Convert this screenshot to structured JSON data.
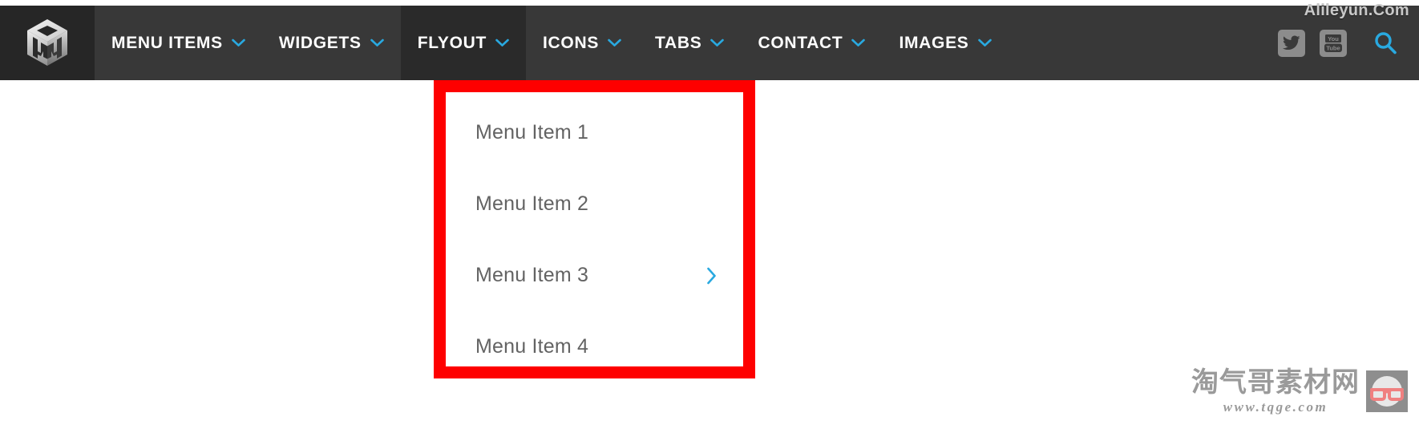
{
  "colors": {
    "navbar_bg": "#383838",
    "logo_block_bg": "#262626",
    "nav_active_bg": "#2a2a2a",
    "accent_blue": "#29a9e0",
    "highlight_red": "#fe0000",
    "menu_text": "#636363",
    "social_tile": "#8c8c8c",
    "watermark_gray": "#9a9a9a"
  },
  "navbar": {
    "logo": {
      "icon": "cube-m-logo"
    },
    "items": [
      {
        "label": "MENU ITEMS",
        "icon": "chevron-down-icon",
        "active": false
      },
      {
        "label": "WIDGETS",
        "icon": "chevron-down-icon",
        "active": false
      },
      {
        "label": "FLYOUT",
        "icon": "chevron-down-icon",
        "active": true
      },
      {
        "label": "ICONS",
        "icon": "chevron-down-icon",
        "active": false
      },
      {
        "label": "TABS",
        "icon": "chevron-down-icon",
        "active": false
      },
      {
        "label": "CONTACT",
        "icon": "chevron-down-icon",
        "active": false
      },
      {
        "label": "IMAGES",
        "icon": "chevron-down-icon",
        "active": false
      }
    ],
    "right": {
      "social": [
        {
          "name": "twitter-icon",
          "label": "Twitter"
        },
        {
          "name": "youtube-icon",
          "label": "You Tube"
        }
      ],
      "youtube_top_text": "You",
      "youtube_bottom_text": "Tube",
      "search": {
        "name": "search-icon",
        "label": "Search"
      }
    }
  },
  "flyout": {
    "items": [
      {
        "label": "Menu Item 1",
        "has_submenu": false,
        "submenu_icon": ""
      },
      {
        "label": "Menu Item 2",
        "has_submenu": false,
        "submenu_icon": ""
      },
      {
        "label": "Menu Item 3",
        "has_submenu": true,
        "submenu_icon": "chevron-right-icon"
      },
      {
        "label": "Menu Item 4",
        "has_submenu": false,
        "submenu_icon": ""
      }
    ]
  },
  "watermarks": {
    "top_right": "Alileyun.Com",
    "bottom_cn": "淘气哥素材网",
    "bottom_url": "www.tqge.com",
    "bottom_logo_icon": "glasses-face-icon"
  }
}
